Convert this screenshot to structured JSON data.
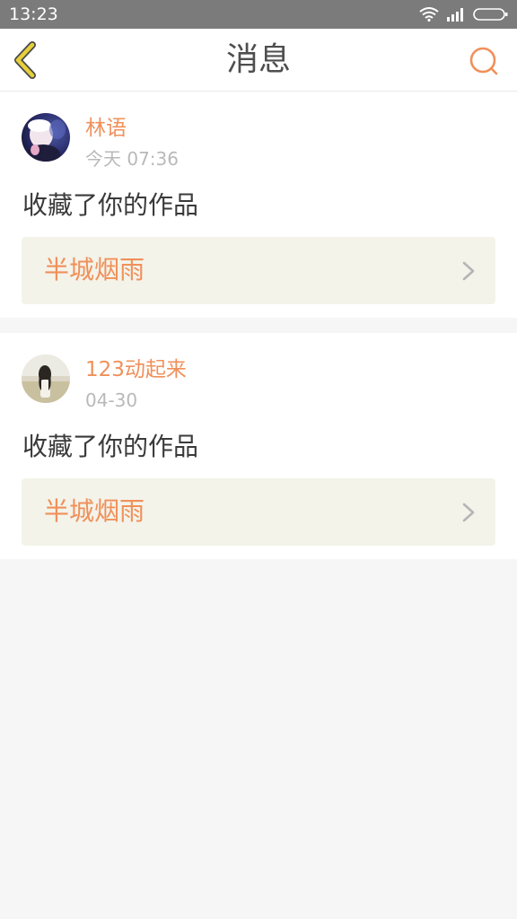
{
  "status_bar": {
    "time": "13:23"
  },
  "header": {
    "title": "消息",
    "back_icon": "chevron-left-icon",
    "search_icon": "search-icon"
  },
  "colors": {
    "accent": "#f0905a",
    "back_icon": "#e6cf3a",
    "card_link_bg": "#f3f3ea",
    "page_bg": "#f6f6f6",
    "status_bar_bg": "#7b7b7b"
  },
  "messages": [
    {
      "username": "林语",
      "time": "今天 07:36",
      "action": "收藏了你的作品",
      "work_title": "半城烟雨"
    },
    {
      "username": "123动起来",
      "time": "04-30",
      "action": "收藏了你的作品",
      "work_title": "半城烟雨"
    }
  ]
}
